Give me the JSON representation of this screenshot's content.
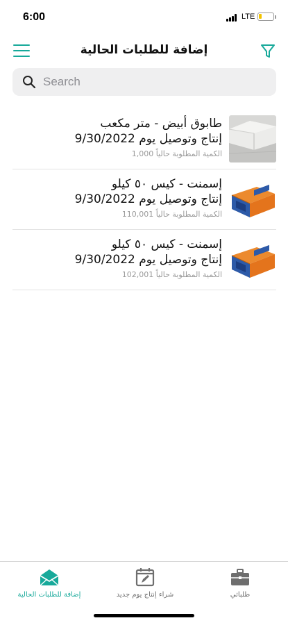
{
  "status_bar": {
    "time": "6:00",
    "network": "LTE",
    "battery_level": 0.2
  },
  "header": {
    "title": "إضافة للطلبات الحالية",
    "menu_icon": "hamburger-icon",
    "filter_icon": "filter-icon"
  },
  "search": {
    "placeholder": "Search",
    "value": ""
  },
  "items": [
    {
      "name": "طابوق أبيض - متر مكعب",
      "date_line": "إنتاج وتوصيل يوم 9/30/2022",
      "qty_line": "الكمية المطلوبة حالياً 1,000",
      "thumb": "white-block-image"
    },
    {
      "name": "إسمنت - كيس ٥٠ كيلو",
      "date_line": "إنتاج وتوصيل يوم 9/30/2022",
      "qty_line": "الكمية المطلوبة حالياً 110,001",
      "thumb": "cement-bag-image"
    },
    {
      "name": "إسمنت - كيس ٥٠ كيلو",
      "date_line": "إنتاج وتوصيل يوم 9/30/2022",
      "qty_line": "الكمية المطلوبة حالياً 102,001",
      "thumb": "cement-bag-image"
    }
  ],
  "tabbar": {
    "tabs": [
      {
        "label": "إضافة للطلبات الحالية",
        "icon": "envelope-open-icon",
        "active": true
      },
      {
        "label": "شراء إنتاج يوم جديد",
        "icon": "calendar-edit-icon",
        "active": false
      },
      {
        "label": "طلباتي",
        "icon": "briefcase-icon",
        "active": false
      }
    ]
  },
  "colors": {
    "accent": "#17a99a",
    "inactive": "#6e6e6e",
    "search_bg": "#efeff0",
    "divider": "#e3e3e3"
  }
}
